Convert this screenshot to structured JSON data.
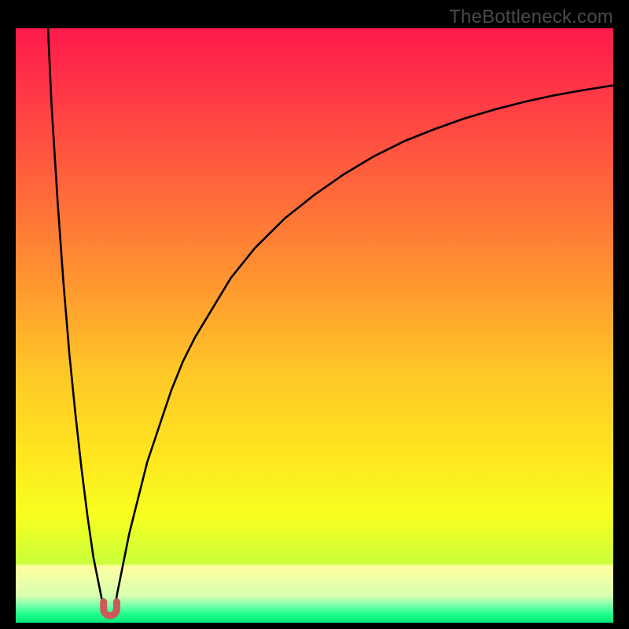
{
  "watermark": {
    "text": "TheBottleneck.com"
  },
  "frame": {
    "outer_w": 800,
    "outer_h": 800,
    "inner_left": 20,
    "inner_top": 36,
    "inner_w": 760,
    "inner_h": 756
  },
  "colors": {
    "curve": "#000000",
    "marker": "#cc5a5a",
    "frame": "#000000"
  },
  "chart_data": {
    "type": "line",
    "title": "",
    "xlabel": "",
    "ylabel": "",
    "xlim": [
      0,
      100
    ],
    "ylim": [
      0,
      100
    ],
    "note": "Two branches of a bottleneck curve meeting near x≈15, y≈2. Values are read off pixel positions of the plotted curves (x and y both 0–100 scale).",
    "series": [
      {
        "name": "left-branch",
        "x": [
          5.4,
          6,
          7,
          8,
          9,
          10,
          11,
          12,
          13,
          14,
          14.5,
          15
        ],
        "values": [
          100,
          87,
          71,
          57,
          45,
          35,
          26,
          18,
          11,
          6,
          3.5,
          2
        ]
      },
      {
        "name": "right-branch",
        "x": [
          16.5,
          17,
          18,
          19,
          20,
          22,
          24,
          26,
          28,
          30,
          33,
          36,
          40,
          45,
          50,
          55,
          60,
          65,
          70,
          75,
          80,
          85,
          90,
          95,
          100
        ],
        "values": [
          2,
          5,
          10,
          15,
          19,
          27,
          33,
          39,
          44,
          48,
          53,
          58,
          63,
          68,
          72,
          75.5,
          78.5,
          81,
          83,
          84.8,
          86.3,
          87.6,
          88.7,
          89.6,
          90.4
        ]
      }
    ],
    "marker": {
      "name": "minimum-marker",
      "shape": "u",
      "x_center": 15.8,
      "y_top": 3.5,
      "y_bottom": 1.2,
      "half_width": 1.1
    },
    "gradient_stops": [
      {
        "offset": 0.0,
        "color": "#ff1a4b"
      },
      {
        "offset": 0.12,
        "color": "#ff3b46"
      },
      {
        "offset": 0.28,
        "color": "#ff6a3a"
      },
      {
        "offset": 0.44,
        "color": "#ff9a2f"
      },
      {
        "offset": 0.58,
        "color": "#ffc727"
      },
      {
        "offset": 0.72,
        "color": "#ffe61f"
      },
      {
        "offset": 0.82,
        "color": "#f7ff1f"
      },
      {
        "offset": 0.9,
        "color": "#c9ff3a"
      },
      {
        "offset": 0.905,
        "color": "#ffffa0"
      },
      {
        "offset": 0.955,
        "color": "#d7ffb0"
      },
      {
        "offset": 0.97,
        "color": "#7dffac"
      },
      {
        "offset": 0.985,
        "color": "#22ff8e"
      },
      {
        "offset": 1.0,
        "color": "#00e878"
      }
    ]
  }
}
